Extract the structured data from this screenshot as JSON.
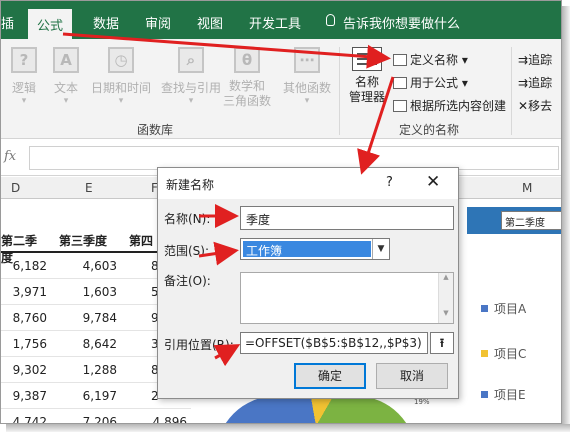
{
  "ribbon": {
    "tabs": [
      "公式",
      "数据",
      "审阅",
      "视图",
      "开发工具"
    ],
    "tab_left_partial": "插",
    "tell_me": "告诉我你想要做什么",
    "function_buttons": [
      {
        "label": "逻辑",
        "icon": "?"
      },
      {
        "label": "文本",
        "icon": "A"
      },
      {
        "label": "日期和时间",
        "icon": "◷"
      },
      {
        "label": "查找与引用",
        "icon": "⌕"
      },
      {
        "label": "数学和\n三角函数",
        "icon": "θ"
      },
      {
        "label": "其他函数",
        "icon": "⋯"
      }
    ],
    "function_group_label": "函数库",
    "name_manager_label": "名称\n管理器",
    "define_name": "定义名称",
    "use_in_formula": "用于公式",
    "create_from_selection": "根据所选内容创建",
    "defined_names_group_label": "定义的名称",
    "trace_precedents": "追踪",
    "trace_dependents": "追踪",
    "remove_arrows": "移去"
  },
  "formula_bar": {
    "fx": "fx"
  },
  "columns": {
    "D": "D",
    "E": "E",
    "F": "F",
    "M": "M"
  },
  "table": {
    "headers": [
      "第二季度",
      "第三季度",
      "第四"
    ],
    "rows": [
      [
        "6,182",
        "4,603",
        "8"
      ],
      [
        "3,971",
        "1,603",
        "5"
      ],
      [
        "8,760",
        "9,784",
        "9"
      ],
      [
        "1,756",
        "8,642",
        "3"
      ],
      [
        "9,302",
        "1,288",
        "8"
      ],
      [
        "9,387",
        "6,197",
        "2"
      ],
      [
        "4,742",
        "7,206",
        "4,896"
      ]
    ]
  },
  "chart": {
    "selector_value": "第二季度",
    "legend": [
      {
        "label": "项目A",
        "color": "#4a76c5"
      },
      {
        "label": "项目C",
        "color": "#f1c232"
      },
      {
        "label": "项目E",
        "color": "#4a76c5"
      }
    ],
    "pct_label": "19%"
  },
  "dialog": {
    "title": "新建名称",
    "help": "?",
    "close": "✕",
    "name_label": "名称(N):",
    "name_value": "季度",
    "scope_label": "范围(S):",
    "scope_value": "工作簿",
    "comment_label": "备注(O):",
    "ref_label": "引用位置(R):",
    "ref_value": "=OFFSET($B$5:$B$12,,$P$3)",
    "ok": "确定",
    "cancel": "取消"
  },
  "colors": {
    "excel_green": "#217346",
    "arrow_red": "#e02020",
    "selection_blue": "#3a88e0"
  }
}
